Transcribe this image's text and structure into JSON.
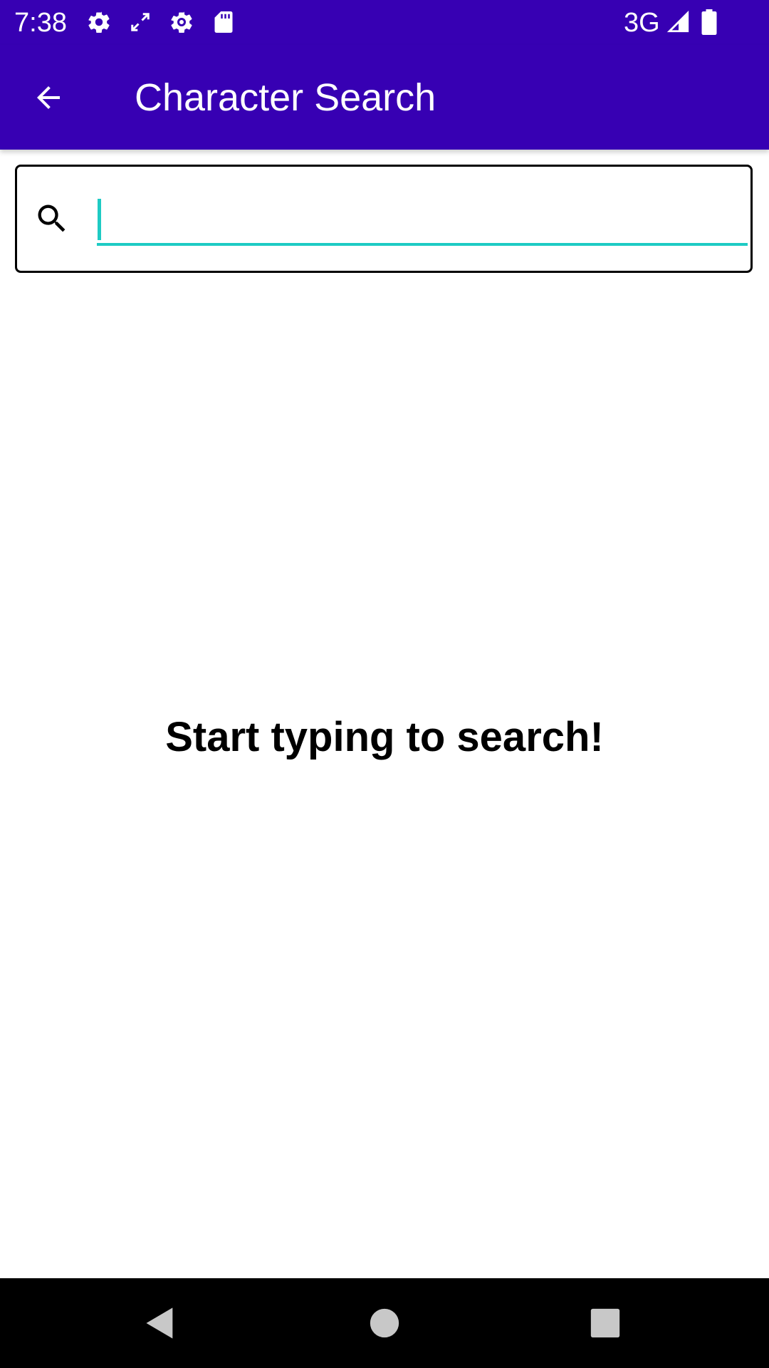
{
  "status_bar": {
    "time": "7:38",
    "network": "3G",
    "icons": [
      "settings-icon",
      "screen-rotate-icon",
      "settings-outline-icon",
      "sd-card-icon",
      "signal-icon",
      "battery-icon"
    ],
    "background": "#3700b3"
  },
  "app_bar": {
    "title": "Character Search",
    "back_icon": "arrow-back-icon",
    "background": "#3700b3"
  },
  "search": {
    "icon": "search-icon",
    "value": "",
    "placeholder": "",
    "accent": "#1ecbc4"
  },
  "empty_state": {
    "message": "Start typing to search!"
  },
  "nav_bar": {
    "buttons": [
      "back-triangle-icon",
      "home-circle-icon",
      "recents-square-icon"
    ]
  }
}
